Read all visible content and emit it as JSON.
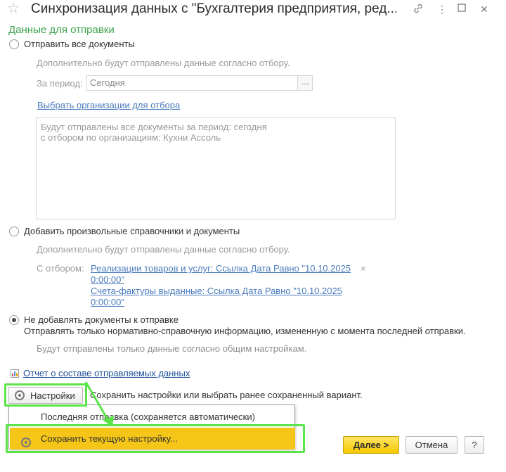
{
  "window": {
    "title": "Синхронизация данных с \"Бухгалтерия предприятия, ред...",
    "star_icon": "star-icon",
    "link_icon": "chain-link-icon",
    "more_icon": "kebab-menu-icon",
    "minimize_icon": "minimize-icon",
    "close_icon": "close-icon"
  },
  "section_title": "Данные для отправки",
  "option_all": {
    "label": "Отправить все документы",
    "note": "Дополнительно будут отправлены данные согласно отбору.",
    "period_label": "За период:",
    "period_value": "Сегодня",
    "period_button": "...",
    "org_link": "Выбрать организации для отбора",
    "memo_line1": "Будут отправлены все документы за период: сегодня",
    "memo_line2": "с отбором по организациям: Кухни Ассоль"
  },
  "option_custom": {
    "label": "Добавить произвольные справочники и документы",
    "note": "Дополнительно будут отправлены данные согласно отбору.",
    "filter_label": "С отбором:",
    "filter1_line1": "Реализации товаров и услуг: Ссылка Дата Равно \"10.10.2025",
    "filter1_line2": "0:00:00\"",
    "filter2_line1": "Счета-фактуры выданные: Ссылка Дата Равно \"10.10.2025",
    "filter2_line2": "0:00:00\"",
    "remove_symbol": "×"
  },
  "option_none": {
    "label": "Не добавлять документы к отправке",
    "description": "Отправлять только нормативно-справочную информацию, измененную с момента последней отправки.",
    "note": "Будут отправлены только данные согласно общим настройкам.",
    "selected": true
  },
  "report_link": "Отчет о составе отправляемых данных",
  "settings": {
    "button_label": "Настройки",
    "hint": "Сохранить настройки или выбрать ранее сохраненный вариант."
  },
  "menu": {
    "items": [
      {
        "label": "Последняя отправка (сохраняется автоматически)",
        "highlighted": false
      },
      {
        "label": "Сохранить текущую настройку...",
        "highlighted": true
      }
    ]
  },
  "footer": {
    "next_label": "Далее >",
    "cancel_label": "Отмена",
    "help_label": "?"
  },
  "colors": {
    "accent_green": "#3aa24a",
    "annotation_green": "#5be44a",
    "primary_yellow": "#f6c800",
    "link_blue": "#4a7bbd"
  }
}
